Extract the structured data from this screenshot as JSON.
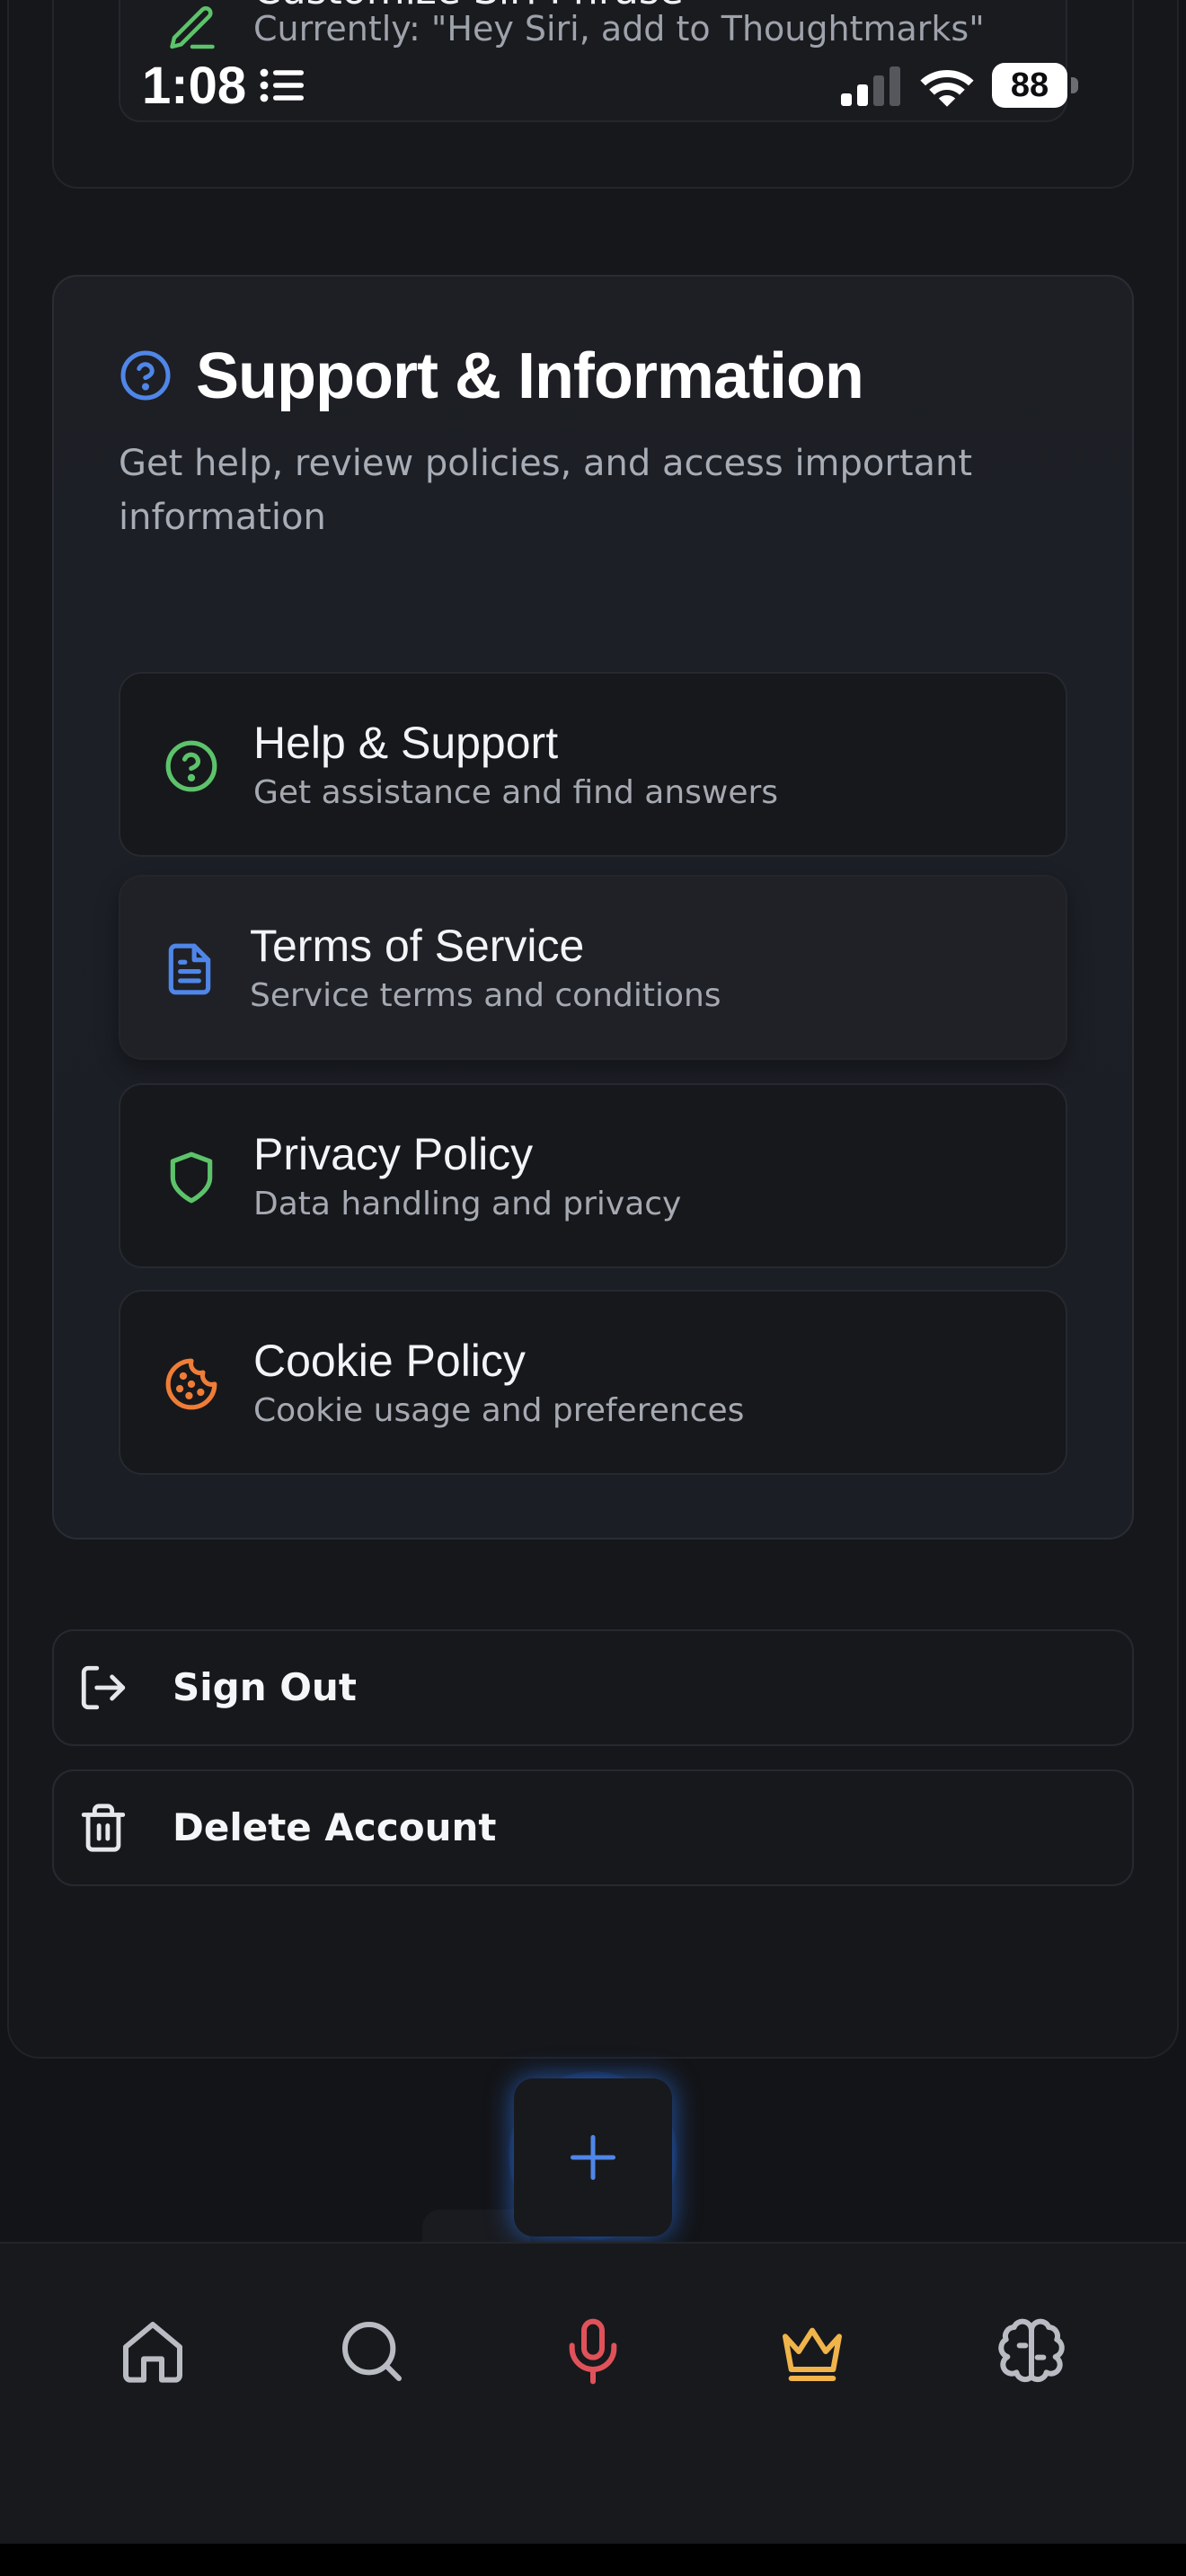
{
  "siri_section": {
    "title": "Customize Siri Phrase",
    "subtitle": "Currently: \"Hey Siri, add to Thoughtmarks\""
  },
  "status_bar": {
    "time": "1:08",
    "battery": "88"
  },
  "support": {
    "title": "Support & Information",
    "description": "Get help, review policies, and access important information",
    "items": [
      {
        "title": "Help & Support",
        "subtitle": "Get assistance and find answers",
        "icon": "help-circle-icon",
        "color": "#5cc36a"
      },
      {
        "title": "Terms of Service",
        "subtitle": "Service terms and conditions",
        "icon": "document-icon",
        "color": "#4f86e8"
      },
      {
        "title": "Privacy Policy",
        "subtitle": "Data handling and privacy",
        "icon": "shield-icon",
        "color": "#5cc36a"
      },
      {
        "title": "Cookie Policy",
        "subtitle": "Cookie usage and preferences",
        "icon": "cookie-icon",
        "color": "#ef7d37"
      }
    ]
  },
  "account": {
    "sign_out": "Sign Out",
    "delete_account": "Delete Account"
  },
  "tabs": [
    {
      "name": "home",
      "icon": "home-icon",
      "color": "#b9bcc3"
    },
    {
      "name": "search",
      "icon": "search-icon",
      "color": "#b9bcc3"
    },
    {
      "name": "voice",
      "icon": "microphone-icon",
      "color": "#e0525a"
    },
    {
      "name": "premium",
      "icon": "crown-icon",
      "color": "#f0b44a"
    },
    {
      "name": "ai",
      "icon": "brain-icon",
      "color": "#b9bcc3"
    }
  ],
  "colors": {
    "accent_blue": "#4f86e8",
    "background": "#131417"
  }
}
